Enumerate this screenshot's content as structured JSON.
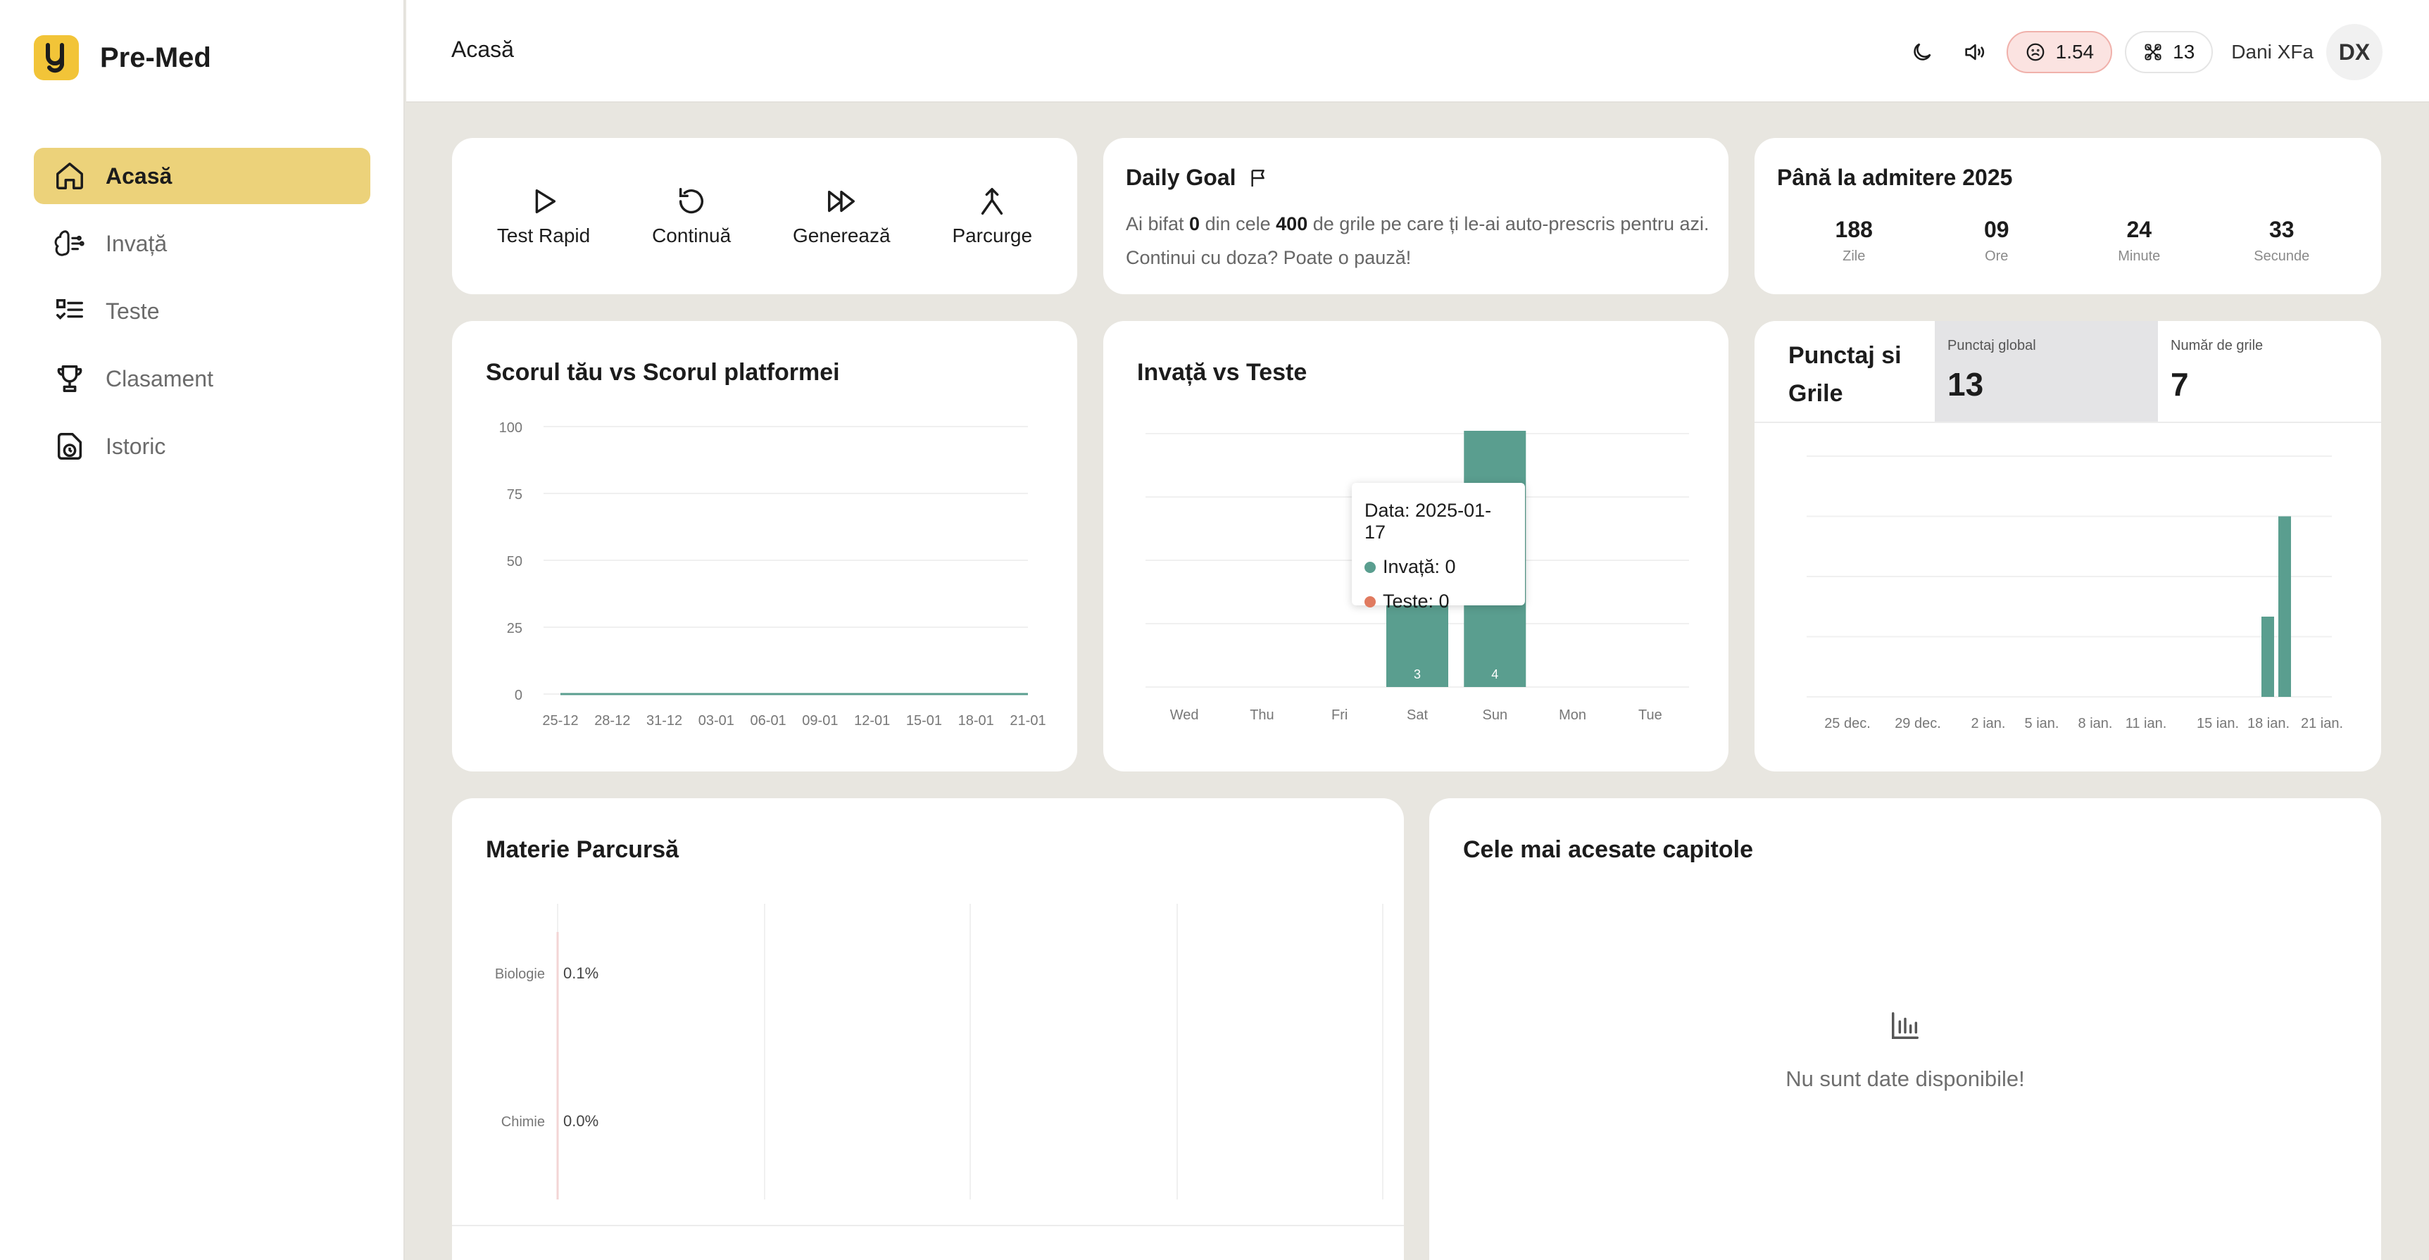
{
  "app": {
    "name": "Pre-Med"
  },
  "sidebar": {
    "items": [
      {
        "label": "Acasă",
        "icon": "home-icon",
        "active": true
      },
      {
        "label": "Invață",
        "icon": "brain-icon",
        "active": false
      },
      {
        "label": "Teste",
        "icon": "checklist-icon",
        "active": false
      },
      {
        "label": "Clasament",
        "icon": "trophy-icon",
        "active": false
      },
      {
        "label": "Istoric",
        "icon": "history-icon",
        "active": false
      }
    ]
  },
  "header": {
    "title": "Acasă",
    "score": "1.54",
    "count": "13",
    "user_name": "Dani XFa",
    "avatar": "DX"
  },
  "quick_actions": [
    {
      "label": "Test Rapid",
      "icon": "play-icon"
    },
    {
      "label": "Continuă",
      "icon": "rotate-icon"
    },
    {
      "label": "Generează",
      "icon": "fast-forward-icon"
    },
    {
      "label": "Parcurge",
      "icon": "merge-icon"
    }
  ],
  "daily_goal": {
    "title": "Daily Goal",
    "text_1": "Ai bifat ",
    "done": "0",
    "text_2": " din cele ",
    "target": "400",
    "text_3": " de grile pe care ți le-ai auto-prescris pentru azi. Continui cu doza? Poate o pauză!"
  },
  "countdown": {
    "title": "Până la admitere 2025",
    "units": [
      {
        "value": "188",
        "label": "Zile"
      },
      {
        "value": "09",
        "label": "Ore"
      },
      {
        "value": "24",
        "label": "Minute"
      },
      {
        "value": "33",
        "label": "Secunde"
      }
    ]
  },
  "points": {
    "title": "Punctaj si Grile",
    "global_label": "Punctaj global",
    "global_value": "13",
    "questions_label": "Număr de grile",
    "questions_value": "7"
  },
  "tooltip": {
    "date": "Data: 2025-01-17",
    "learn": "Invață: 0",
    "tests": "Teste: 0"
  },
  "empty_state": {
    "text": "Nu sunt date disponibile!",
    "icon": "bar-chart-icon"
  },
  "colors": {
    "accent": "#ecd27a",
    "logo": "#f2c438",
    "bar": "#5a9e8f",
    "test": "#e07a5f"
  },
  "chart_data": [
    {
      "type": "line",
      "title": "Scorul tău vs Scorul platformei",
      "x": [
        "25-12",
        "28-12",
        "31-12",
        "03-01",
        "06-01",
        "09-01",
        "12-01",
        "15-01",
        "18-01",
        "21-01"
      ],
      "yticks": [
        0,
        25,
        50,
        75,
        100
      ],
      "ylim": [
        0,
        100
      ],
      "series": [
        {
          "values": [
            0,
            0,
            0,
            0,
            0,
            0,
            0,
            0,
            0,
            0
          ]
        }
      ],
      "grid": true
    },
    {
      "type": "bar",
      "title": "Invață vs Teste",
      "categories": [
        "Wed",
        "Thu",
        "Fri",
        "Sat",
        "Sun",
        "Mon",
        "Tue"
      ],
      "series": [
        {
          "values": [
            0,
            0,
            0,
            3,
            4,
            0,
            0
          ]
        }
      ],
      "data_labels": [
        "",
        "",
        "",
        "3",
        "4",
        "",
        ""
      ],
      "ylim": [
        0,
        4
      ],
      "grid": true
    },
    {
      "type": "bar",
      "x": [
        "25 dec.",
        "29 dec.",
        "2 ian.",
        "5 ian.",
        "8 ian.",
        "11 ian.",
        "15 ian.",
        "18 ian.",
        "21 ian."
      ],
      "bars": [
        {
          "x": "17 ian.",
          "value": 4
        },
        {
          "x": "18 ian.",
          "value": 9
        }
      ],
      "ylim": [
        0,
        12
      ],
      "grid": true
    },
    {
      "type": "bar",
      "title": "Materie Parcursă",
      "orientation": "horizontal",
      "categories": [
        "Biologie",
        "Chimie"
      ],
      "values": [
        0.1,
        0.0
      ],
      "data_labels": [
        "0.1%",
        "0.0%"
      ]
    }
  ],
  "chapters": {
    "title": "Cele mai acesate capitole"
  }
}
